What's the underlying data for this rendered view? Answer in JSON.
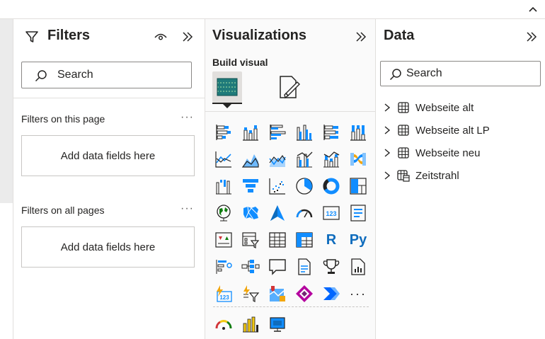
{
  "filters": {
    "title": "Filters",
    "search_placeholder": "Search",
    "this_page_label": "Filters on this page",
    "this_page_drop": "Add data fields here",
    "all_pages_label": "Filters on all pages",
    "all_pages_drop": "Add data fields here",
    "more": "···"
  },
  "visualizations": {
    "title": "Visualizations",
    "build_label": "Build visual",
    "more_visuals": "···",
    "r_label": "R",
    "py_label": "Py",
    "icons": [
      [
        "stacked-bar-icon",
        "stacked-column-icon",
        "clustered-bar-icon",
        "clustered-column-icon",
        "100-stacked-bar-icon",
        "100-stacked-column-icon"
      ],
      [
        "line-chart-icon",
        "area-chart-icon",
        "stacked-area-icon",
        "line-clustered-column-icon",
        "line-stacked-column-icon",
        "ribbon-chart-icon"
      ],
      [
        "waterfall-icon",
        "funnel-icon",
        "scatter-icon",
        "pie-icon",
        "donut-icon",
        "treemap-icon"
      ],
      [
        "map-icon",
        "filled-map-icon",
        "azure-map-icon",
        "gauge-icon",
        "card-icon",
        "multi-row-card-icon"
      ],
      [
        "kpi-icon",
        "slicer-icon",
        "table-icon",
        "matrix-icon",
        "r-visual-icon",
        "python-visual-icon"
      ],
      [
        "key-influencers-icon",
        "decomposition-tree-icon",
        "qa-icon",
        "narrative-icon",
        "goals-icon",
        "paginated-report-icon"
      ],
      [
        "power-apps-card-icon",
        "power-apps-filter-icon",
        "power-automate-map-icon",
        "power-apps-icon",
        "power-automate-icon",
        "more-visuals-icon"
      ]
    ]
  },
  "data": {
    "title": "Data",
    "search_placeholder": "Search",
    "tables": [
      {
        "label": "Webseite alt",
        "icon": "table-icon"
      },
      {
        "label": "Webseite alt LP",
        "icon": "table-icon"
      },
      {
        "label": "Webseite neu",
        "icon": "table-icon"
      },
      {
        "label": "Zeitstrahl",
        "icon": "calendar-table-icon"
      }
    ]
  },
  "colors": {
    "accent_blue": "#118dff",
    "dark_blue": "#0f6cbd",
    "teal": "#1f7a7a",
    "yellow": "#f2c811",
    "border": "#c8c6c4"
  }
}
